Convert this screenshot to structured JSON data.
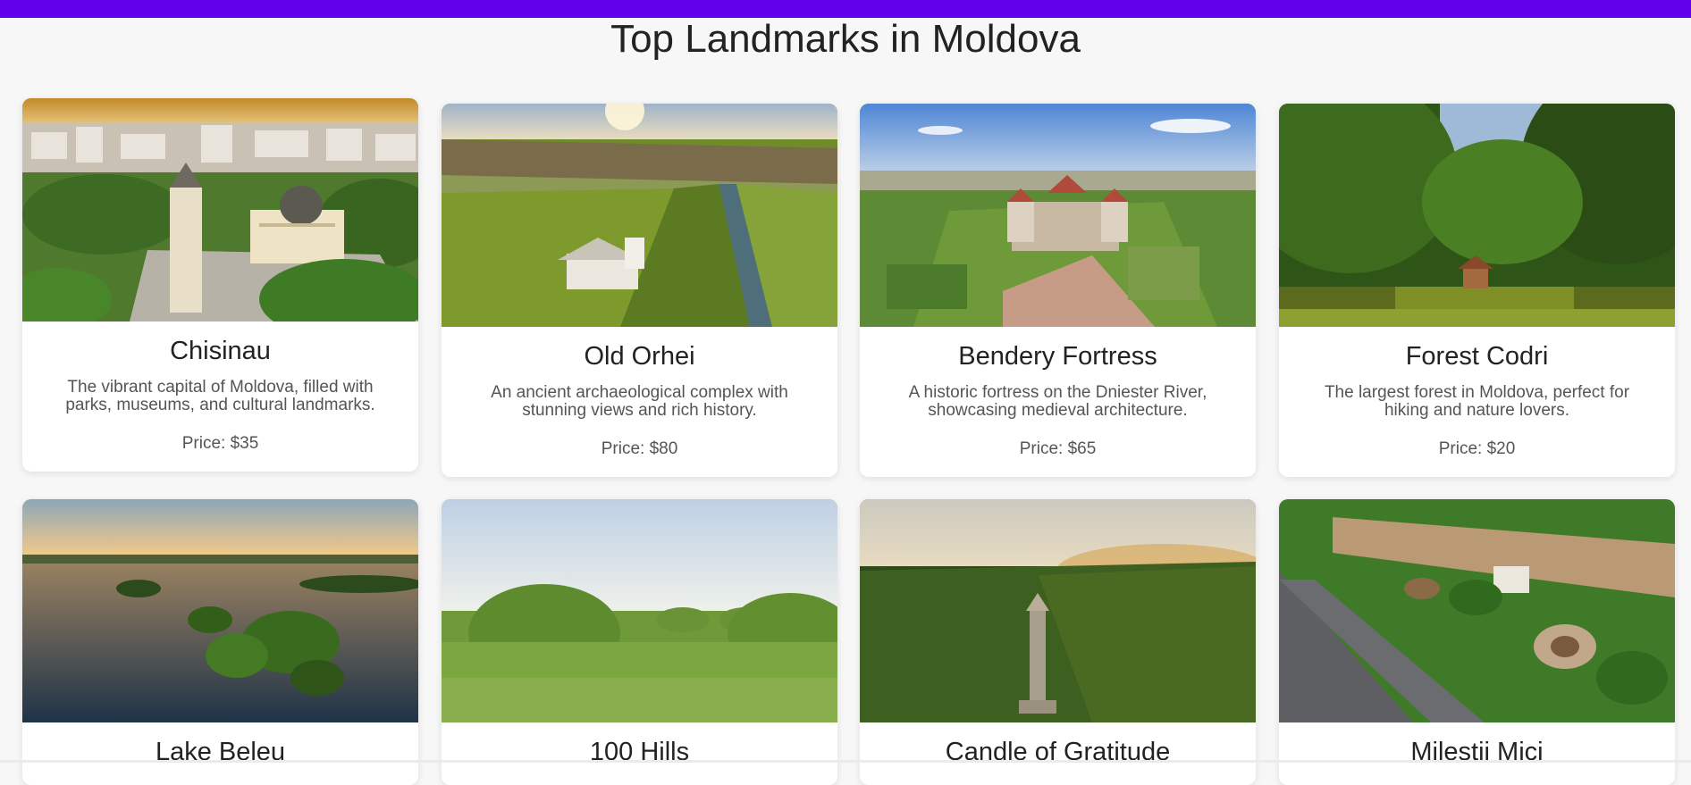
{
  "page": {
    "title": "Top Landmarks in Moldova",
    "accent_color": "#6200ea"
  },
  "landmarks": [
    {
      "name": "Chisinau",
      "description": "The vibrant capital of Moldova, filled with parks, museums, and cultural landmarks.",
      "price": "Price: $35",
      "image": "city-cathedral-aerial-photo"
    },
    {
      "name": "Old Orhei",
      "description": "An ancient archaeological complex with stunning views and rich history.",
      "price": "Price: $80",
      "image": "river-canyon-monastery-photo"
    },
    {
      "name": "Bendery Fortress",
      "description": "A historic fortress on the Dniester River, showcasing medieval architecture.",
      "price": "Price: $65",
      "image": "fortress-aerial-photo"
    },
    {
      "name": "Forest Codri",
      "description": "The largest forest in Moldova, perfect for hiking and nature lovers.",
      "price": "Price: $20",
      "image": "forest-lake-pavilion-photo"
    },
    {
      "name": "Lake Beleu",
      "image": "lake-sunset-trees-photo"
    },
    {
      "name": "100 Hills",
      "image": "green-hills-meadow-photo"
    },
    {
      "name": "Candle of Gratitude",
      "image": "monument-forest-sunrise-photo"
    },
    {
      "name": "Milestii Mici",
      "image": "winery-garden-aerial-photo"
    }
  ]
}
